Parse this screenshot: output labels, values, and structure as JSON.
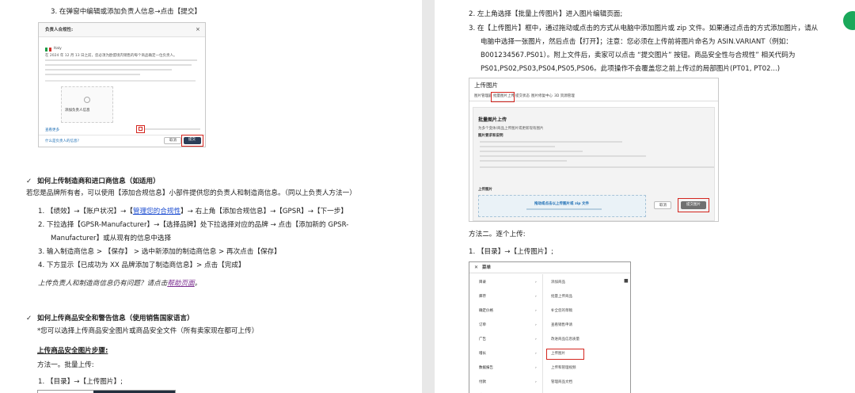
{
  "left": {
    "step3_title": "3. 在弹窗中编辑或添加负责人信息→点击【提交】",
    "dialog": {
      "title": "负责人合规性:",
      "close": "×",
      "flag_label": "Italy",
      "body_text": "在 2024 年 12 月 13 日之前，您必须为欧盟境内销售的每个商品确定一位负责人。",
      "placeholder": "添加负责人信息",
      "bottom_link": "查看更多",
      "help_link": "什么是负责人的信息?",
      "cancel": "取消",
      "submit": "提交"
    },
    "section1": {
      "check": "✓",
      "heading": "如何上传制造商和进口商信息（如适用）",
      "intro": "若您是品牌所有者，可以使用【添加合规信息】小部件提供您的负责人和制造商信息。（同以上负责人方法一）",
      "item1_a": "1.  【绩效】→【账户状况】→【",
      "item1_link": "管理您的合规性",
      "item1_b": "】→ 右上角【添加合规信息】→【GPSR】→【下一步】",
      "item2_line1": "2.  下拉选择【GPSR-Manufacturer】→【选择品牌】处下拉选择对应的品牌 → 点击【添加新的 GPSR-",
      "item2_line2": "Manufacturer】或从现有的信息中选择",
      "item3": "3.  输入制造商信息 > 【保存】 > 选中新添加的制造商信息 > 再次点击【保存】",
      "item4": "4.  下方显示【已成功为 XX 品牌添加了制造商信息】> 点击【完成】",
      "note_a": "上传负责人和制造商信息仍有问题？请点击",
      "note_link": "帮助页面",
      "note_b": "。"
    },
    "section2": {
      "check": "✓",
      "heading": "如何上传商品安全和警告信息（使用销售国家语言）",
      "note": "*您可以选择上传商品安全图片或商品安全文件（所有卖家现在都可上传）",
      "sub_heading": "上传商品安全图片步骤:",
      "method1": "方法一。批量上传:",
      "step1": "1.  【目录】→【上传图片】;"
    }
  },
  "right": {
    "step2": "2.  左上角选择【批量上传图片】进入图片编辑页面;",
    "step3_l1": "3.  在【上传图片】框中，通过拖动或点击的方式从电脑中添加图片或 zip 文件。如果通过点击的方式添加图片，请从",
    "step3_l2": "电脑中选择一张图片，然后点击【打开】；注意：您必须在上传前将图片命名为 ASIN.VARIANT（例如：",
    "step3_l3": "B001234567.PS01）。附上文件后，卖家可以点击 “提交图片” 按钮。商品安全性与合规性” 相关代码为",
    "step3_l4": "PS01,PS02,PS03,PS04,PS05,PS06。此项操作不会覆盖您之前上传过的局部图片(PT01, PT02...)",
    "upload_shot": {
      "title": "上传图片",
      "tabs": [
        "图片管理器",
        "批量图片上传",
        "提交状态",
        "图片修复中心",
        "3D 资源管理"
      ],
      "panel_title": "批量图片上传",
      "panel_desc": "为多个变体/商品上传图片或更新现有图片",
      "requirements": "图片要求和说明",
      "upload_label": "上传图片",
      "drop_text": "拖动或点击以上传图片或 zip 文件",
      "cancel": "取消",
      "submit": "提交图片"
    },
    "method2": "方法二。逐个上传:",
    "step1": "1.  【目录】→【上传图片】;",
    "menu_shot": {
      "header": "菜单",
      "left_items": [
        "目录",
        "库存",
        "确定价格",
        "订单",
        "广告",
        "增长",
        "数据报告",
        "付款",
        "绩效"
      ],
      "right_items": [
        "添加商品",
        "批量上传商品",
        "补全您的草稿",
        "查看销售申请",
        "改进商品信息质量",
        "上传图片",
        "上传和管理视频",
        "管理商品文档"
      ]
    }
  },
  "colors": {
    "accent": "#d4261f",
    "link": "#1f4fd1",
    "amazon_dark": "#232f3e"
  }
}
